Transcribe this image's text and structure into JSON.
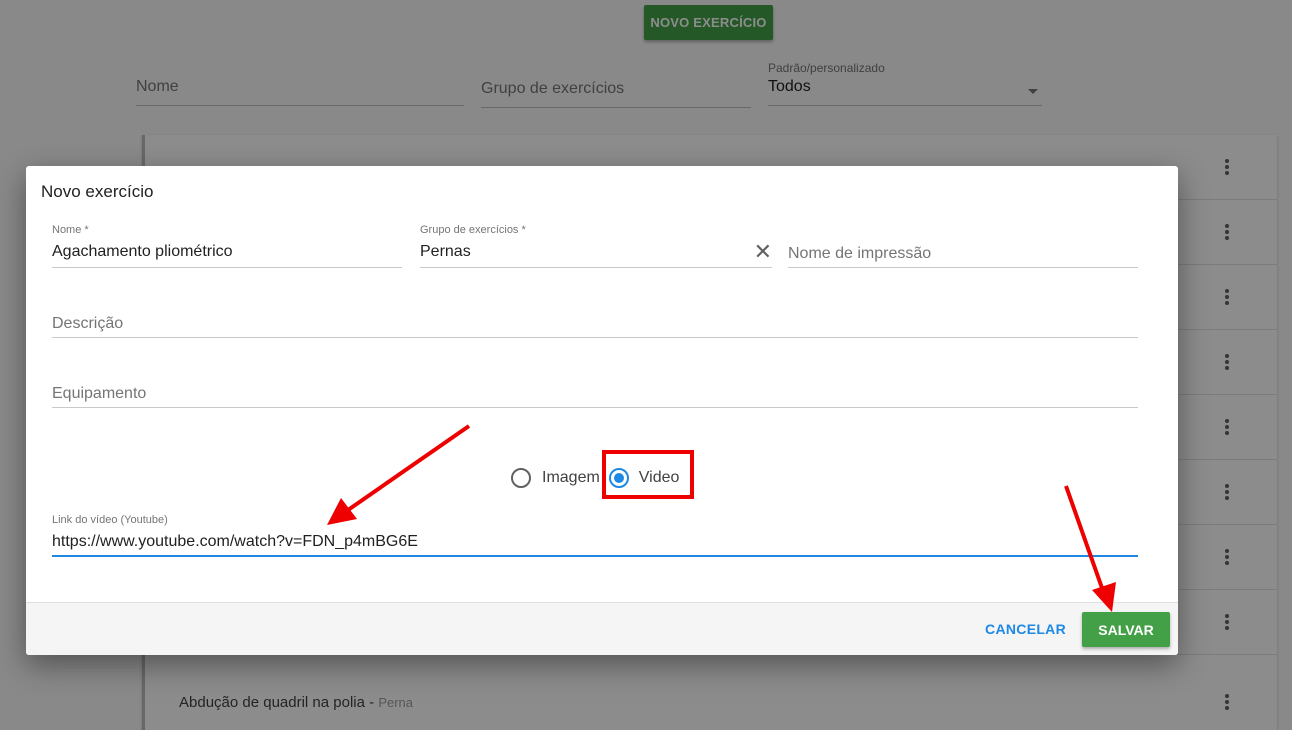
{
  "background": {
    "new_exercise_button": "NOVO EXERCÍCIO",
    "filters": {
      "name_placeholder": "Nome",
      "group_placeholder": "Grupo de exercícios",
      "type_label": "Padrão/personalizado",
      "type_value": "Todos"
    },
    "list": {
      "last_item_name": "Abdução de quadril na polia - ",
      "last_item_group": "Perna"
    }
  },
  "dialog": {
    "title": "Novo exercício",
    "fields": {
      "name_label": "Nome *",
      "name_value": "Agachamento pliométrico",
      "group_label": "Grupo de exercícios *",
      "group_value": "Pernas",
      "print_name_placeholder": "Nome de impressão",
      "description_placeholder": "Descrição",
      "equipment_placeholder": "Equipamento",
      "video_link_label": "Link do vídeo (Youtube)",
      "video_link_value": "https://www.youtube.com/watch?v=FDN_p4mBG6E"
    },
    "media_options": {
      "image_label": "Imagem",
      "video_label": "Video",
      "selected": "Video"
    },
    "footer": {
      "cancel_label": "CANCELAR",
      "save_label": "SALVAR"
    }
  },
  "colors": {
    "accent_blue": "#1e88e5",
    "primary_green": "#43a047",
    "annotation_red": "#ee0000"
  }
}
